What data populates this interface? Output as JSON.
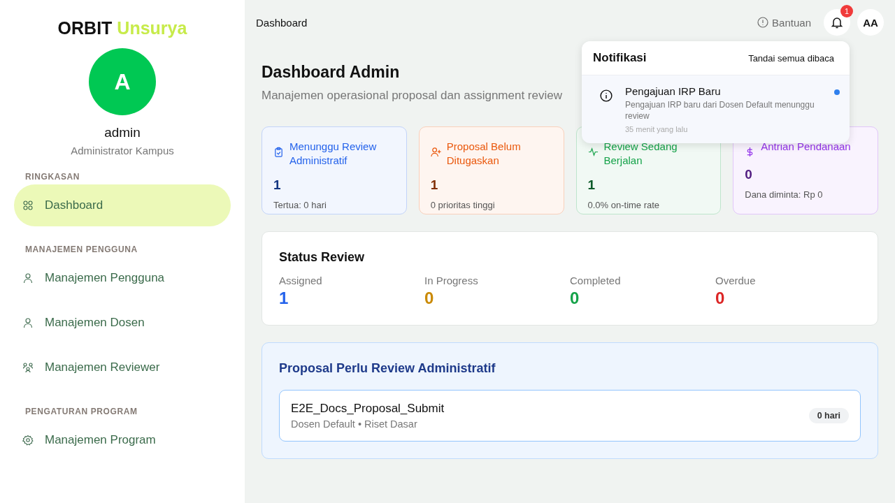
{
  "sidebar": {
    "brand": {
      "primary": "ORBIT",
      "accent": "Unsurya"
    },
    "avatar": "A",
    "user_name": "admin",
    "user_role": "Administrator Kampus",
    "sections": [
      {
        "title": "RINGKASAN",
        "items": [
          {
            "label": "Dashboard",
            "kind": "grid",
            "selected": true
          }
        ]
      },
      {
        "title": "MANAJEMEN PENGGUNA",
        "items": [
          {
            "label": "Manajemen Pengguna",
            "kind": "user",
            "selected": false
          },
          {
            "label": "Manajemen Dosen",
            "kind": "user",
            "selected": false
          },
          {
            "label": "Manajemen Reviewer",
            "kind": "group",
            "selected": false
          }
        ]
      },
      {
        "title": "PENGATURAN PROGRAM",
        "items": [
          {
            "label": "Manajemen Program",
            "kind": "gear",
            "selected": false
          }
        ]
      }
    ]
  },
  "topbar": {
    "breadcrumb": "Dashboard",
    "help": "Bantuan",
    "notification_count": "1",
    "user_initials": "AA"
  },
  "header": {
    "title": "Dashboard Admin",
    "subtitle": "Manajemen operasional proposal dan assignment review"
  },
  "stats": [
    {
      "kind": "clipboard",
      "color": "#2563eb",
      "title": "Menunggu Review Administratif",
      "value": "1",
      "note": "Tertua: 0 hari"
    },
    {
      "kind": "user-plus",
      "color": "#ea580c",
      "title": "Proposal Belum Ditugaskan",
      "value": "1",
      "note": "0 prioritas tinggi"
    },
    {
      "kind": "activity",
      "color": "#16a34a",
      "title": "Review Sedang Berjalan",
      "value": "1",
      "note": "0.0% on-time rate"
    },
    {
      "kind": "dollar",
      "color": "#9333ea",
      "title": "Antrian Pendanaan",
      "value": "0",
      "note": "Dana diminta: Rp 0"
    }
  ],
  "status_review": {
    "title": "Status Review",
    "items": [
      {
        "label": "Assigned",
        "value": "1",
        "color": "#2563eb"
      },
      {
        "label": "In Progress",
        "value": "0",
        "color": "#ca8a04"
      },
      {
        "label": "Completed",
        "value": "0",
        "color": "#16a34a"
      },
      {
        "label": "Overdue",
        "value": "0",
        "color": "#dc2626"
      }
    ]
  },
  "pending": {
    "title": "Proposal Perlu Review Administratif",
    "items": [
      {
        "name": "E2E_Docs_Proposal_Submit",
        "meta": "Dosen Default • Riset Dasar",
        "age": "0 hari"
      }
    ]
  },
  "notifications": {
    "title": "Notifikasi",
    "mark_all": "Tandai semua dibaca",
    "items": [
      {
        "title": "Pengajuan IRP Baru",
        "body": "Pengajuan IRP baru dari Dosen Default menunggu review",
        "time": "35 menit yang lalu",
        "unread": true
      }
    ]
  }
}
